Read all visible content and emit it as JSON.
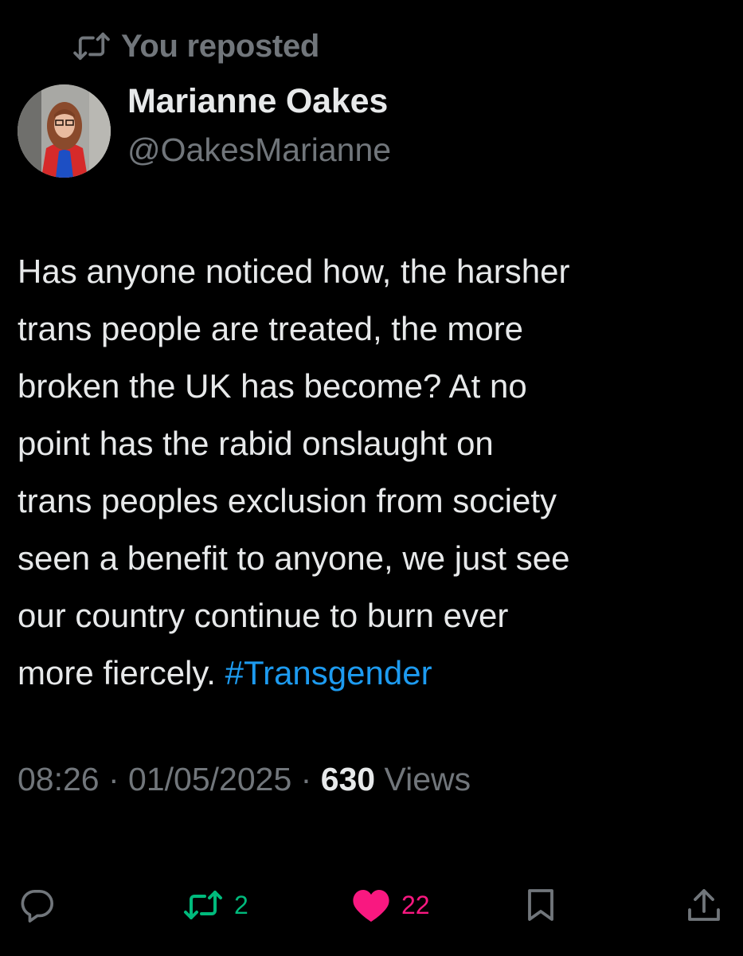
{
  "repost_banner": {
    "icon": "repost-icon",
    "label": "You reposted"
  },
  "author": {
    "avatar": "avatar",
    "name": "Marianne Oakes",
    "handle": "@OakesMarianne"
  },
  "post": {
    "lines": [
      "Has anyone noticed how, the harsher",
      "trans people are treated, the more",
      "broken the UK has become? At no",
      "point has the rabid onslaught on",
      "trans peoples exclusion from society",
      "seen a benefit to anyone, we just see",
      "our country continue to burn ever"
    ],
    "last_line_text": "more fiercely. ",
    "hashtag": "#Transgender"
  },
  "meta": {
    "time": "08:26",
    "separator": " · ",
    "date": "01/05/2025",
    "views_count": "630",
    "views_label": " Views"
  },
  "actions": {
    "reply": {
      "icon": "reply-icon",
      "count": ""
    },
    "repost": {
      "icon": "repost-icon",
      "count": "2"
    },
    "like": {
      "icon": "heart-icon",
      "count": "22"
    },
    "bookmark": {
      "icon": "bookmark-icon"
    },
    "share": {
      "icon": "share-icon"
    }
  },
  "colors": {
    "background": "#000000",
    "primary_text": "#e7e9ea",
    "secondary_text": "#71767b",
    "link": "#1d9bf0",
    "repost_active": "#00ba7c",
    "like_active": "#f91880"
  }
}
